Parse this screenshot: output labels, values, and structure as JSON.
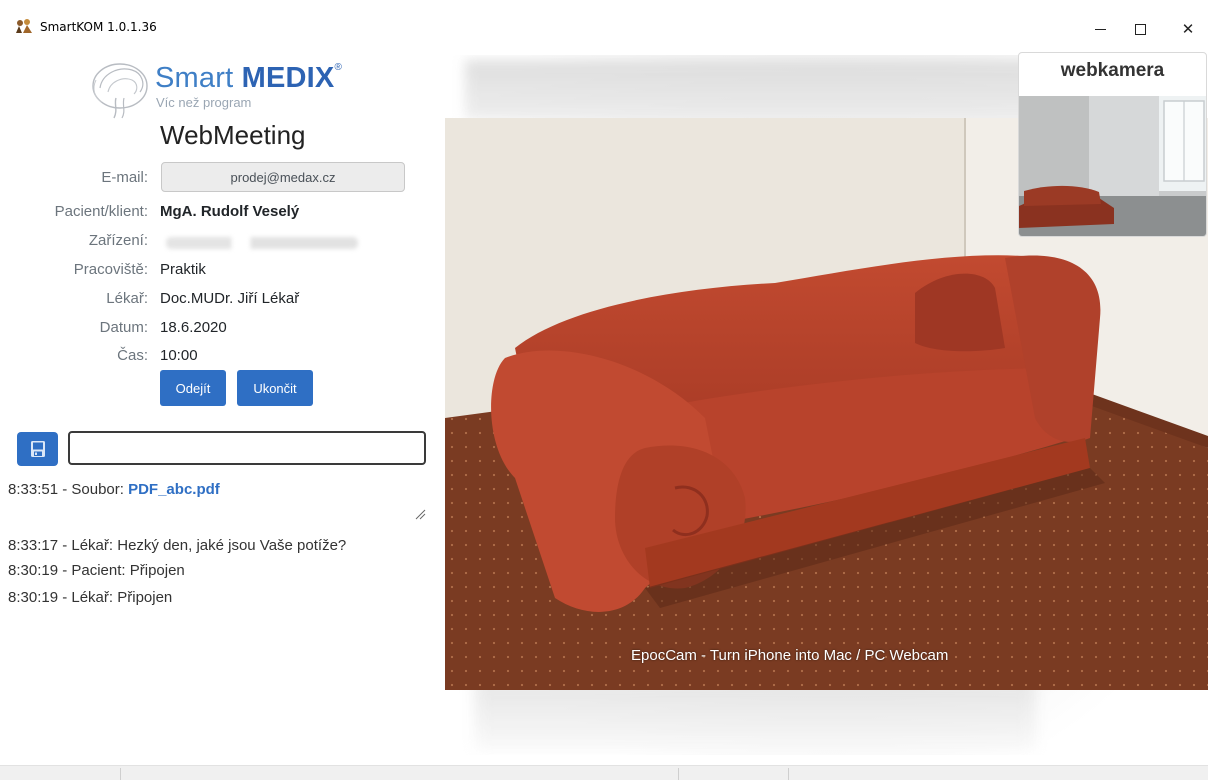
{
  "window": {
    "title": "SmartKOM 1.0.1.36",
    "controls": {
      "minimize": "minimize-icon",
      "maximize": "maximize-icon",
      "close": "close-icon"
    }
  },
  "logo": {
    "brand_light": "Smart",
    "brand_bold": "MEDIX",
    "registered": "®",
    "tagline": "Víc než program"
  },
  "heading": "WebMeeting",
  "form": {
    "email": {
      "label": "E-mail:",
      "value": "prodej@medax.cz"
    },
    "patient": {
      "label": "Pacient/klient:",
      "value": "MgA. Rudolf Veselý"
    },
    "device": {
      "label": "Zařízení:"
    },
    "workplace": {
      "label": "Pracoviště:",
      "value": "Praktik"
    },
    "doctor": {
      "label": "Lékař:",
      "value": "Doc.MUDr. Jiří Lékař"
    },
    "date": {
      "label": "Datum:",
      "value": "18.6.2020"
    },
    "time": {
      "label": "Čas:",
      "value": "10:00"
    }
  },
  "buttons": {
    "leave": "Odejít",
    "end": "Ukončit"
  },
  "chat": {
    "save_icon": "floppy-disk-icon",
    "input_value": "",
    "file_message": {
      "prefix": "8:33:51 - Soubor: ",
      "file": "PDF_abc.pdf"
    },
    "log": [
      "8:33:17 - Lékař: Hezký den, jaké jsou Vaše potíže?",
      "8:30:19 - Pacient: Připojen",
      "8:30:19 - Lékař: Připojen"
    ]
  },
  "video": {
    "caption": "EpocCam - Turn iPhone into Mac / PC Webcam"
  },
  "webcam": {
    "title": "webkamera"
  },
  "colors": {
    "accent": "#2f6fc4",
    "brand": "#3f7fc6",
    "sofa": "#b8402a",
    "carpet": "#7a3b22"
  }
}
